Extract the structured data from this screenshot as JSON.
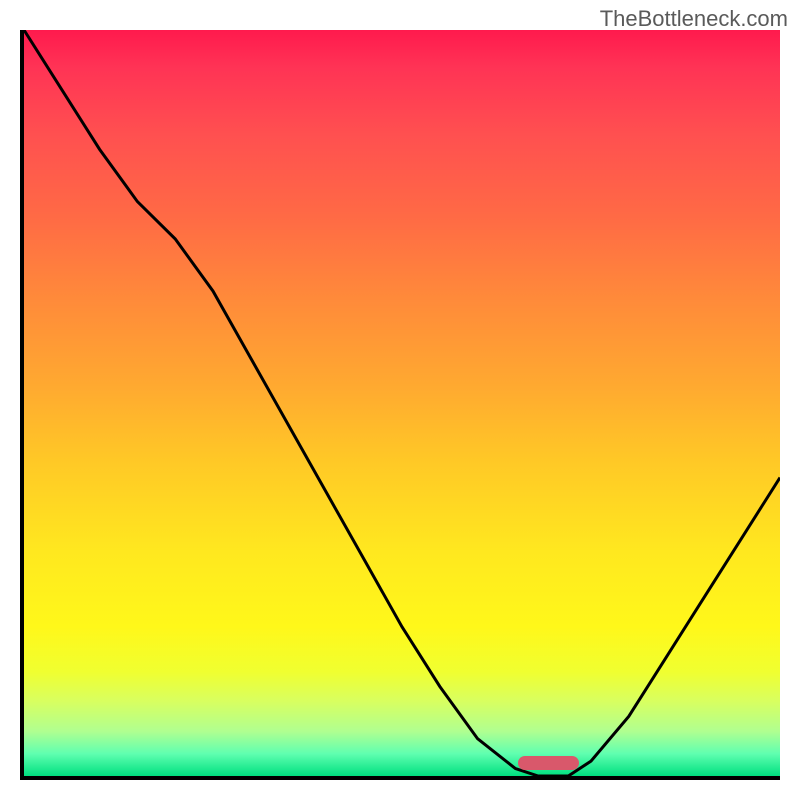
{
  "watermark": "TheBottleneck.com",
  "chart_data": {
    "type": "line",
    "title": "",
    "xlabel": "",
    "ylabel": "",
    "x": [
      0.0,
      0.05,
      0.1,
      0.15,
      0.2,
      0.25,
      0.3,
      0.35,
      0.4,
      0.45,
      0.5,
      0.55,
      0.6,
      0.65,
      0.68,
      0.72,
      0.75,
      0.8,
      0.85,
      0.9,
      0.95,
      1.0
    ],
    "values": [
      1.0,
      0.92,
      0.84,
      0.77,
      0.72,
      0.65,
      0.56,
      0.47,
      0.38,
      0.29,
      0.2,
      0.12,
      0.05,
      0.01,
      0.0,
      0.0,
      0.02,
      0.08,
      0.16,
      0.24,
      0.32,
      0.4
    ],
    "ylim": [
      0,
      1
    ],
    "xlim": [
      0,
      1
    ],
    "optimal_range": [
      0.65,
      0.73
    ],
    "gradient_colors": {
      "top": "#ff1a4d",
      "mid": "#ffe81f",
      "bottom": "#00e080"
    },
    "marker_color": "#d9586b"
  }
}
